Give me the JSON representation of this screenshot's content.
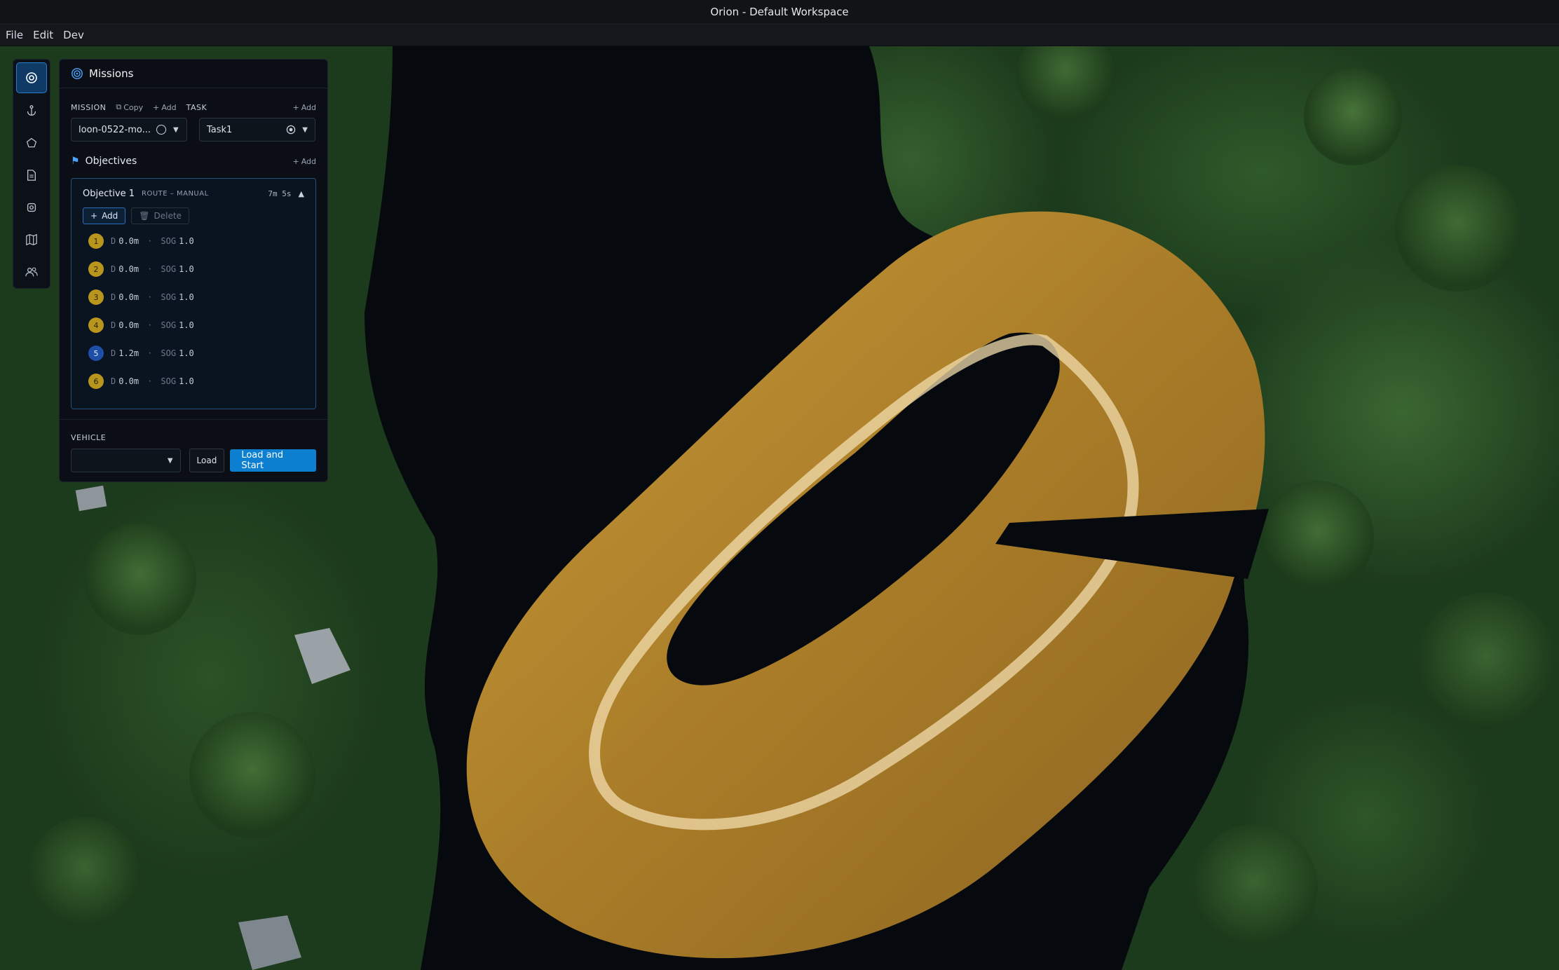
{
  "window": {
    "title": "Orion - Default Workspace"
  },
  "menu": [
    "File",
    "Edit",
    "Dev"
  ],
  "rail": [
    {
      "icon": "target-icon",
      "active": true
    },
    {
      "icon": "anchor-icon",
      "active": false
    },
    {
      "icon": "pentagon-icon",
      "active": false
    },
    {
      "icon": "document-icon",
      "active": false
    },
    {
      "icon": "settings-icon",
      "active": false
    },
    {
      "icon": "map-icon",
      "active": false
    },
    {
      "icon": "users-icon",
      "active": false
    }
  ],
  "missions": {
    "title": "Missions",
    "mission_label": "MISSION",
    "copy_label": "Copy",
    "add_label": "Add",
    "task_label": "TASK",
    "task_add_label": "Add",
    "mission_value": "loon-0522-mo...",
    "task_value": "Task1"
  },
  "objectives": {
    "title": "Objectives",
    "add_label": "Add",
    "objective": {
      "name": "Objective 1",
      "kind": "ROUTE – MANUAL",
      "duration": "7m 5s",
      "add_label": "Add",
      "delete_label": "Delete",
      "waypoints": [
        {
          "num": "1",
          "d_label": "D",
          "depth": "0.0m",
          "sog_label": "SOG",
          "sog": "1.0",
          "style": "yellow"
        },
        {
          "num": "2",
          "d_label": "D",
          "depth": "0.0m",
          "sog_label": "SOG",
          "sog": "1.0",
          "style": "yellow"
        },
        {
          "num": "3",
          "d_label": "D",
          "depth": "0.0m",
          "sog_label": "SOG",
          "sog": "1.0",
          "style": "yellow"
        },
        {
          "num": "4",
          "d_label": "D",
          "depth": "0.0m",
          "sog_label": "SOG",
          "sog": "1.0",
          "style": "yellow"
        },
        {
          "num": "5",
          "d_label": "D",
          "depth": "1.2m",
          "sog_label": "SOG",
          "sog": "1.0",
          "style": "blue"
        },
        {
          "num": "6",
          "d_label": "D",
          "depth": "0.0m",
          "sog_label": "SOG",
          "sog": "1.0",
          "style": "yellow"
        }
      ]
    }
  },
  "vehicle": {
    "label": "VEHICLE",
    "value": "",
    "load_label": "Load",
    "start_label": "Load and Start"
  },
  "colors": {
    "accent": "#0d7fd0",
    "waypoint_yellow": "#b8961e",
    "waypoint_blue": "#1d4fa8",
    "sonar": "#b78a2c"
  }
}
